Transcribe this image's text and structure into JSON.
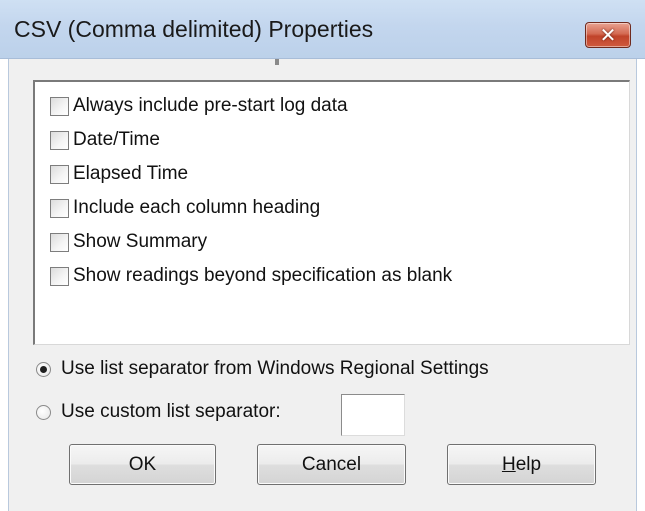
{
  "window": {
    "title": "CSV (Comma delimited) Properties",
    "close_glyph": "✕"
  },
  "options": [
    {
      "label": "Always include pre-start log data",
      "checked": false
    },
    {
      "label": "Date/Time",
      "checked": false
    },
    {
      "label": "Elapsed Time",
      "checked": false
    },
    {
      "label": "Include each column heading",
      "checked": false
    },
    {
      "label": "Show Summary",
      "checked": false
    },
    {
      "label": "Show readings beyond specification as blank",
      "checked": false
    }
  ],
  "separator": {
    "windows_label": "Use list separator from Windows Regional Settings",
    "windows_selected": true,
    "custom_label": "Use custom list separator:",
    "custom_selected": false,
    "custom_value": ""
  },
  "buttons": {
    "ok": "OK",
    "cancel": "Cancel",
    "help_mnemonic": "H",
    "help_rest": "elp"
  },
  "colors": {
    "titlebar": "#c3d6ee",
    "close": "#c0432a",
    "dialog_bg": "#f0f0f0"
  },
  "icons": {
    "close": "close-icon",
    "checkbox": "checkbox-unchecked",
    "radio_selected": "radio-selected",
    "radio_unselected": "radio-unselected"
  }
}
